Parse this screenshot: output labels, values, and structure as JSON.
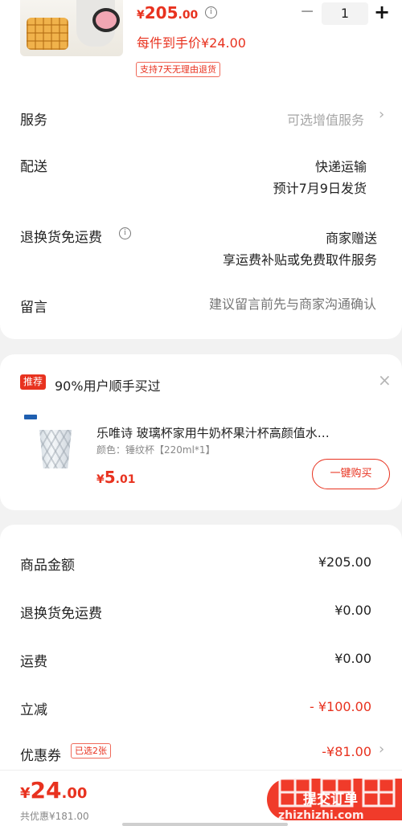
{
  "product": {
    "price_currency": "¥",
    "price_int": "205",
    "price_dec": ".00",
    "info_icon": "ⓘ",
    "per_item_price": "每件到手价¥24.00",
    "return_tag": "支持7天无理由退货",
    "quantity": "1",
    "minus_label": "−",
    "plus_label": "+"
  },
  "rows": {
    "service_label": "服务",
    "service_value": "可选增值服务",
    "delivery_label": "配送",
    "delivery_value": "快递运输",
    "delivery_date": "预计7月9日发货",
    "return_freight_label": "退换货免运费",
    "return_freight_value": "商家赠送",
    "return_freight_desc": "享运费补贴或免费取件服务",
    "message_label": "留言",
    "message_placeholder": "建议留言前先与商家沟通确认",
    "chevron": "›"
  },
  "recommend": {
    "badge": "推荐",
    "title": "90%用户顺手买过",
    "close": "×",
    "name": "乐唯诗 玻璃杯家用牛奶杯果汁杯高颜值水…",
    "spec": "颜色：锤纹杯【220ml*1】",
    "price_currency": "¥",
    "price_int": "5",
    "price_dec": ".01",
    "buy_button": "一键购买"
  },
  "summary": {
    "goods_label": "商品金额",
    "goods_value": "¥205.00",
    "return_label": "退换货免运费",
    "return_value": "¥0.00",
    "shipping_label": "运费",
    "shipping_value": "¥0.00",
    "discount_label": "立减",
    "discount_value": "- ¥100.00",
    "coupon_label": "优惠券",
    "coupon_tag": "已选2张",
    "coupon_value": "-¥81.00"
  },
  "bottom": {
    "total_currency": "¥",
    "total_int": "24",
    "total_dec": ".00",
    "saved": "共优惠¥181.00",
    "submit": "提交订单",
    "watermark_text": "zhizhizhi.com"
  },
  "colors": {
    "accent": "#e8321f",
    "background": "#f2f2f2"
  }
}
